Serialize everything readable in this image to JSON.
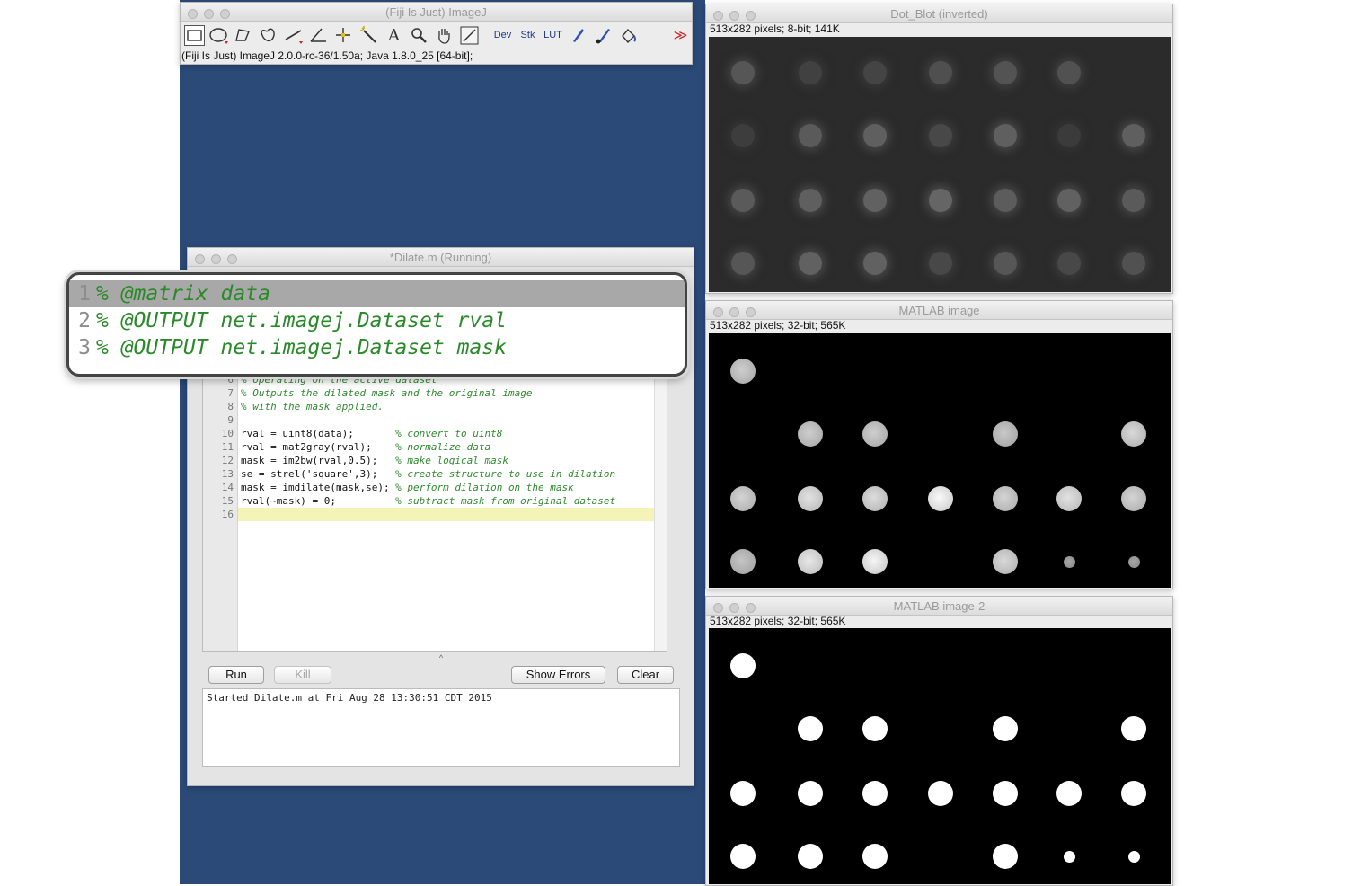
{
  "imagej": {
    "title": "(Fiji Is Just) ImageJ",
    "status": "(Fiji Is Just) ImageJ 2.0.0-rc-36/1.50a; Java 1.8.0_25 [64-bit];",
    "tools": {
      "rectangle": "rectangle-icon",
      "oval": "oval-icon",
      "polygon": "polygon-icon",
      "freehand": "freehand-icon",
      "line": "line-icon",
      "angle": "angle-icon",
      "point": "point-icon",
      "wand": "wand-icon",
      "text": "A",
      "zoom": "magnifier-icon",
      "hand": "hand-icon",
      "color_picker": "dropper-icon",
      "dev": "Dev",
      "stk": "Stk",
      "lut": "LUT",
      "pencil": "pencil-icon",
      "brush": "brush-icon",
      "flood": "flood-fill-icon",
      "more": "≫"
    }
  },
  "editor": {
    "title": "*Dilate.m (Running)",
    "lines": [
      {
        "n": "6",
        "code": "",
        "comment": "% operating on the active dataset"
      },
      {
        "n": "7",
        "code": "",
        "comment": "% Outputs the dilated mask and the original image"
      },
      {
        "n": "8",
        "code": "",
        "comment": "% with the mask applied."
      },
      {
        "n": "9",
        "code": "",
        "comment": ""
      },
      {
        "n": "10",
        "code": "rval = uint8(data);       ",
        "comment": "% convert to uint8"
      },
      {
        "n": "11",
        "code": "rval = mat2gray(rval);    ",
        "comment": "% normalize data"
      },
      {
        "n": "12",
        "code": "mask = im2bw(rval,0.5);   ",
        "comment": "% make logical mask"
      },
      {
        "n": "13",
        "code": "se = strel('square',3);   ",
        "comment": "% create structure to use in dilation"
      },
      {
        "n": "14",
        "code": "mask = imdilate(mask,se); ",
        "comment": "% perform dilation on the mask"
      },
      {
        "n": "15",
        "code": "rval(~mask) = 0;          ",
        "comment": "% subtract mask from original dataset"
      },
      {
        "n": "16",
        "code": "",
        "comment": ""
      }
    ],
    "buttons": {
      "run": "Run",
      "kill": "Kill",
      "show_errors": "Show Errors",
      "clear": "Clear"
    },
    "console": "Started Dilate.m at Fri Aug 28 13:30:51 CDT 2015"
  },
  "callout": [
    {
      "n": "1",
      "text": "% @matrix data"
    },
    {
      "n": "2",
      "text": "% @OUTPUT net.imagej.Dataset rval"
    },
    {
      "n": "3",
      "text": "% @OUTPUT net.imagej.Dataset mask"
    }
  ],
  "windows": {
    "dot_blot": {
      "title": "Dot_Blot (inverted)",
      "info": "513x282 pixels; 8-bit; 141K"
    },
    "matlab1": {
      "title": "MATLAB image",
      "info": "513x282 pixels; 32-bit; 565K"
    },
    "matlab2": {
      "title": "MATLAB image-2",
      "info": "513x282 pixels; 32-bit; 565K"
    }
  }
}
